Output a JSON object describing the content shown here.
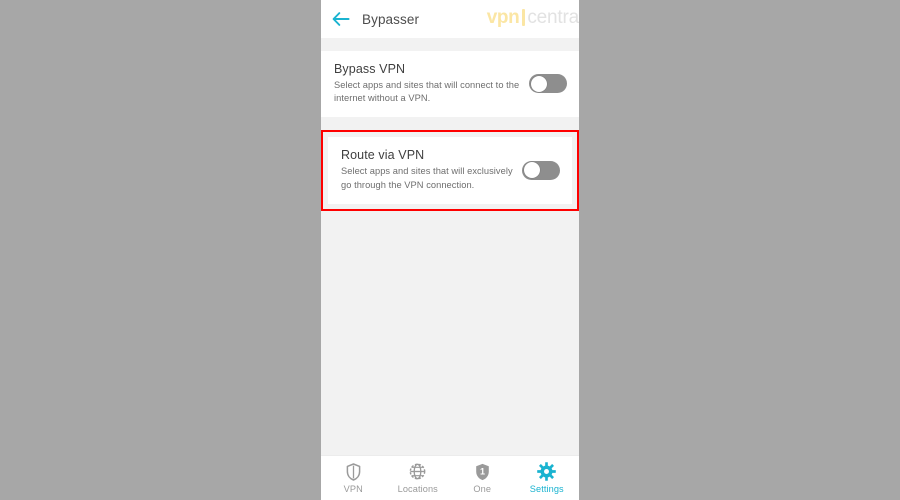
{
  "colors": {
    "accent": "#1ab3d0",
    "highlight_box": "#ff0000",
    "page_background": "#a7a7a7",
    "app_background": "#f2f2f2",
    "card_background": "#ffffff",
    "toggle_off_track": "#8e8e8e",
    "toggle_knob": "#ffffff",
    "brand_yellow": "#fbe6a4",
    "brand_gray": "#e2e2e2",
    "nav_inactive": "#9a9a9a"
  },
  "appbar": {
    "back_icon": "arrow-left-icon",
    "title": "Bypasser",
    "brand": {
      "first": "vpn",
      "second": "central",
      "separator": "|"
    }
  },
  "settings": [
    {
      "key": "bypass_vpn",
      "title": "Bypass VPN",
      "description": "Select apps and sites that will connect to the internet without a VPN.",
      "toggle_state": "off",
      "highlighted": false
    },
    {
      "key": "route_via_vpn",
      "title": "Route via VPN",
      "description": "Select apps and sites that will exclusively go through the VPN connection.",
      "toggle_state": "off",
      "highlighted": true
    }
  ],
  "bottom_nav": {
    "active_index": 3,
    "items": [
      {
        "label": "VPN",
        "icon": "shield-icon",
        "active": false
      },
      {
        "label": "Locations",
        "icon": "globe-icon",
        "active": false
      },
      {
        "label": "One",
        "icon": "shield-one-badge-icon",
        "active": false
      },
      {
        "label": "Settings",
        "icon": "gear-icon",
        "active": true
      }
    ]
  }
}
